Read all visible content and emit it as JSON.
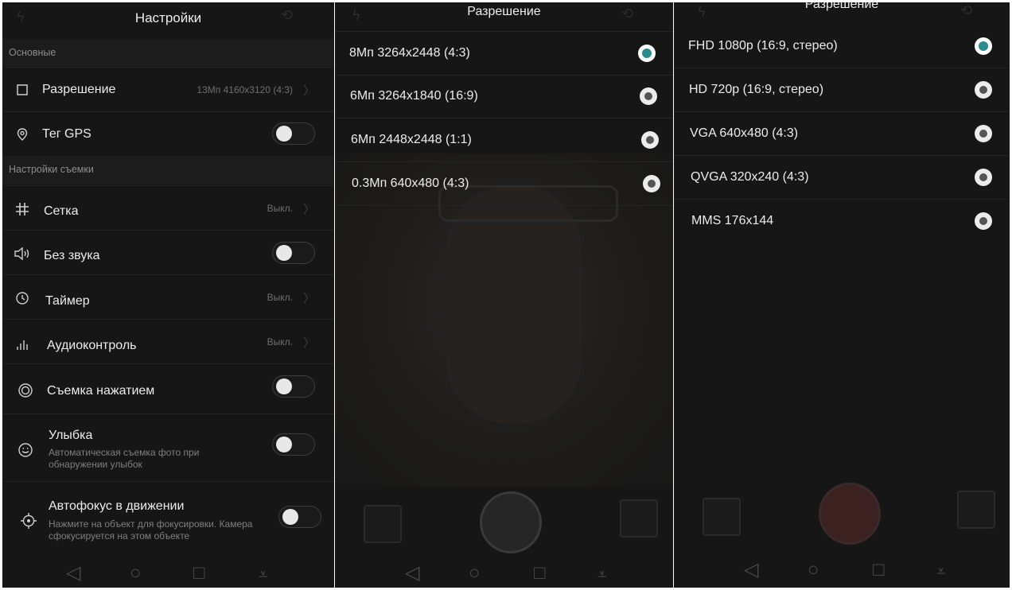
{
  "panel1": {
    "title": "Настройки",
    "section_basic": "Основные",
    "section_shooting": "Настройки съемки",
    "resolution": {
      "label": "Разрешение",
      "value": "13Мп 4160x3120 (4:3)",
      "icon": "crop-square-icon"
    },
    "gps": {
      "label": "Тег GPS",
      "on": false,
      "icon": "location-pin-icon"
    },
    "grid": {
      "label": "Сетка",
      "value": "Выкл.",
      "icon": "grid-icon"
    },
    "mute": {
      "label": "Без звука",
      "on": false,
      "icon": "speaker-icon"
    },
    "timer": {
      "label": "Таймер",
      "value": "Выкл.",
      "icon": "clock-icon"
    },
    "audio": {
      "label": "Аудиоконтроль",
      "value": "Выкл.",
      "icon": "audio-bars-icon"
    },
    "touch": {
      "label": "Съемка нажатием",
      "on": false,
      "icon": "touch-capture-icon"
    },
    "smile": {
      "label": "Улыбка",
      "sub": "Автоматическая съемка фото при обнаружении улыбок",
      "on": false,
      "icon": "smile-icon"
    },
    "af": {
      "label": "Автофокус в движении",
      "sub": "Нажмите на объект для фокусировки. Камера сфокусируется на этом объекте",
      "on": false,
      "icon": "focus-target-icon"
    }
  },
  "panel2": {
    "title": "Разрешение",
    "options": [
      {
        "label": "8Мп 3264x2448 (4:3)",
        "selected": true
      },
      {
        "label": "6Мп 3264x1840 (16:9)",
        "selected": false
      },
      {
        "label": "6Мп 2448x2448 (1:1)",
        "selected": false
      },
      {
        "label": "0.3Мп 640x480 (4:3)",
        "selected": false
      }
    ]
  },
  "panel3": {
    "title": "Разрешение",
    "options": [
      {
        "label": "FHD 1080p (16:9, стерео)",
        "selected": true
      },
      {
        "label": "HD 720p (16:9, стерео)",
        "selected": false
      },
      {
        "label": "VGA 640x480 (4:3)",
        "selected": false
      },
      {
        "label": "QVGA 320x240 (4:3)",
        "selected": false
      },
      {
        "label": "MMS 176x144",
        "selected": false
      }
    ]
  },
  "navbar": {
    "icons": [
      "back-triangle-icon",
      "home-circle-icon",
      "recents-square-icon",
      "notification-pull-icon"
    ]
  },
  "colors": {
    "accent": "#2a8c8c",
    "panel_bg": "#161616",
    "section_bg": "#1c1c1c"
  }
}
